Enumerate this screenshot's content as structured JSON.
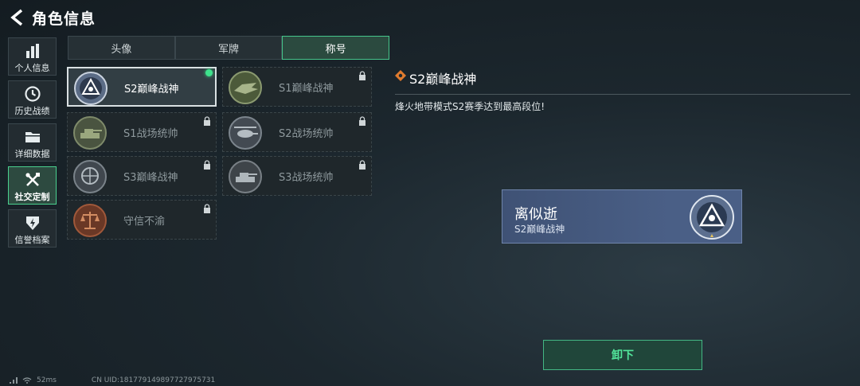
{
  "header": {
    "title": "角色信息"
  },
  "nav": [
    {
      "label": "个人信息",
      "icon": "bar-chart-icon",
      "active": false
    },
    {
      "label": "历史战绩",
      "icon": "history-clock-icon",
      "active": false
    },
    {
      "label": "详细数据",
      "icon": "folder-icon",
      "active": false
    },
    {
      "label": "社交定制",
      "icon": "tools-icon",
      "active": true
    },
    {
      "label": "信誉档案",
      "icon": "shield-lightning-icon",
      "active": false
    }
  ],
  "tabs": [
    {
      "label": "头像",
      "active": false
    },
    {
      "label": "军牌",
      "active": false
    },
    {
      "label": "称号",
      "active": true
    }
  ],
  "titles": [
    {
      "name": "S2巅峰战神",
      "emblem": "peak-warrior-emblem-icon",
      "selected": true,
      "equipped": true,
      "locked": false
    },
    {
      "name": "S1巅峰战神",
      "emblem": "crocodile-emblem-icon",
      "selected": false,
      "equipped": false,
      "locked": true
    },
    {
      "name": "S1战场统帅",
      "emblem": "tank-emblem-icon",
      "selected": false,
      "equipped": false,
      "locked": true
    },
    {
      "name": "S2战场统帅",
      "emblem": "helicopter-emblem-icon",
      "selected": false,
      "equipped": false,
      "locked": true
    },
    {
      "name": "S3巅峰战神",
      "emblem": "globe-emblem-icon",
      "selected": false,
      "equipped": false,
      "locked": true
    },
    {
      "name": "S3战场统帅",
      "emblem": "tank-emblem-icon",
      "selected": false,
      "equipped": false,
      "locked": true
    },
    {
      "name": "守信不渝",
      "emblem": "scales-emblem-icon",
      "selected": false,
      "equipped": false,
      "locked": true
    }
  ],
  "detail": {
    "title": "S2巅峰战神",
    "description": "烽火地带模式S2赛季达到最高段位!"
  },
  "nameplate": {
    "player_name": "离似逝",
    "title": "S2巅峰战神"
  },
  "unequip_button": {
    "label": "卸下"
  },
  "status": {
    "ping": "52ms",
    "uid": "CN UID:181779149897727975731"
  },
  "colors": {
    "accent_green": "#3ee28c",
    "nameplate_blue": "#4a5f86",
    "background": "#1c272e"
  }
}
